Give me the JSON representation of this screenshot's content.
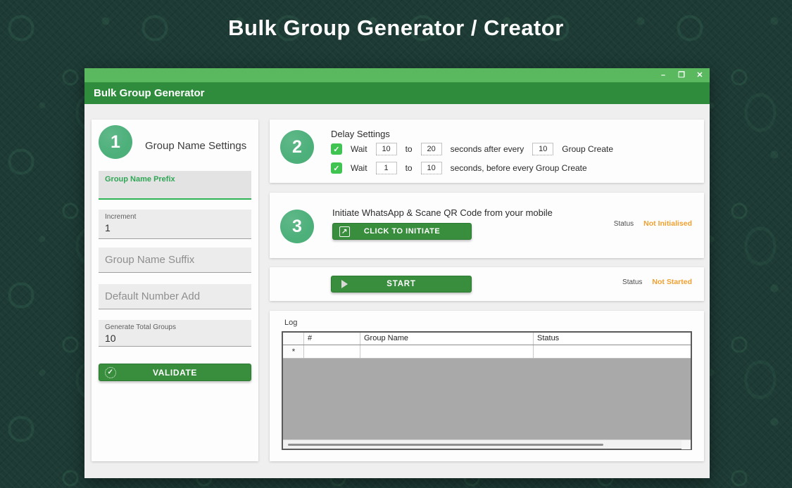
{
  "page_title": "Bulk Group Generator / Creator",
  "window": {
    "title": "Bulk Group Generator",
    "controls": {
      "minimize": "–",
      "maximize": "❐",
      "close": "✕"
    }
  },
  "colors": {
    "titlebar_green": "#2e8c3c",
    "topstrip_green": "#5ab95f",
    "circle_green": "#4db07b",
    "button_green": "#398e3d",
    "checkbox_green": "#3fc351",
    "label_green": "#2fa555",
    "status_orange": "#f0a02f",
    "grid_gray": "#a9a9a9"
  },
  "icons": {
    "validate_badge": "✓",
    "initiate_launch": "↗",
    "start_play": "play-triangle",
    "checkbox_check": "✓"
  },
  "step1": {
    "number": "1",
    "title": "Group Name Settings",
    "prefix": {
      "label": "Group Name Prefix",
      "value": ""
    },
    "increment": {
      "label": "Increment",
      "value": "1"
    },
    "suffix": {
      "placeholder": "Group Name Suffix",
      "value": ""
    },
    "default_number": {
      "placeholder": "Default Number Add",
      "value": ""
    },
    "total_groups": {
      "label": "Generate Total Groups",
      "value": "10"
    },
    "validate_label": "VALIDATE"
  },
  "step2": {
    "number": "2",
    "title": "Delay Settings",
    "row1": {
      "checked": true,
      "wait_label": "Wait",
      "from": "10",
      "to_label": "to",
      "to": "20",
      "after_label": "seconds after every",
      "every": "10",
      "end_label": "Group Create"
    },
    "row2": {
      "checked": true,
      "wait_label": "Wait",
      "from": "1",
      "to_label": "to",
      "to": "10",
      "end_label": "seconds, before every Group Create"
    }
  },
  "step3": {
    "number": "3",
    "title": "Initiate WhatsApp & Scane QR Code from your mobile",
    "button_label": "CLICK TO INITIATE",
    "status_label": "Status",
    "status_value": "Not Initialised"
  },
  "start_section": {
    "button_label": "START",
    "status_label": "Status",
    "status_value": "Not Started"
  },
  "log": {
    "label": "Log",
    "columns": [
      "#",
      "Group Name",
      "Status"
    ],
    "new_row_marker": "*",
    "rows": []
  }
}
